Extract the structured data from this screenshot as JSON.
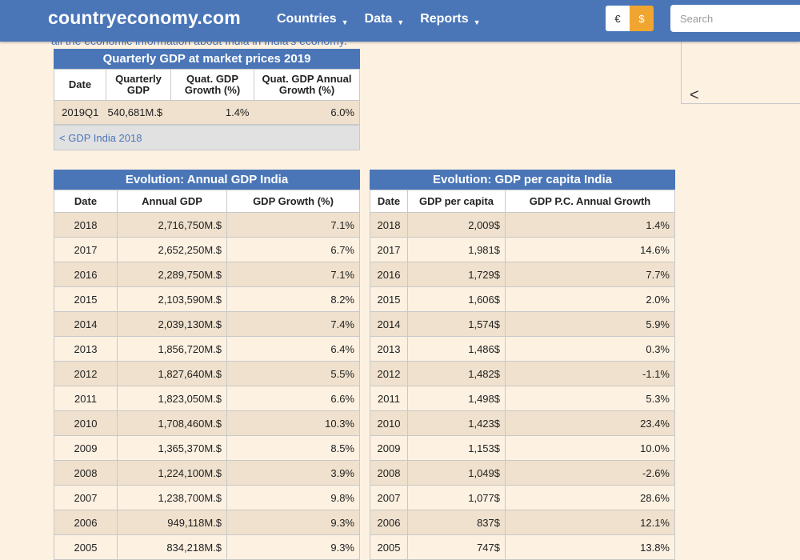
{
  "header": {
    "logo": "countryeconomy.com",
    "nav": [
      {
        "label": "Countries"
      },
      {
        "label": "Data"
      },
      {
        "label": "Reports"
      }
    ],
    "currency_euro": "€",
    "currency_usd": "$",
    "search_placeholder": "Search"
  },
  "intro_text_partial": "all the economic information about India in India's economy.",
  "side_chevron": "<",
  "quarterly": {
    "title": "Quarterly GDP at market prices 2019",
    "headers": [
      "Date",
      "Quarterly GDP",
      "Quat. GDP Growth (%)",
      "Quat. GDP Annual Growth (%)"
    ],
    "rows": [
      [
        "2019Q1",
        "540,681M.$",
        "1.4%",
        "6.0%"
      ]
    ],
    "prev_link": "< GDP India 2018"
  },
  "annual": {
    "title": "Evolution: Annual GDP India",
    "headers": [
      "Date",
      "Annual GDP",
      "GDP Growth (%)"
    ],
    "rows": [
      [
        "2018",
        "2,716,750M.$",
        "7.1%"
      ],
      [
        "2017",
        "2,652,250M.$",
        "6.7%"
      ],
      [
        "2016",
        "2,289,750M.$",
        "7.1%"
      ],
      [
        "2015",
        "2,103,590M.$",
        "8.2%"
      ],
      [
        "2014",
        "2,039,130M.$",
        "7.4%"
      ],
      [
        "2013",
        "1,856,720M.$",
        "6.4%"
      ],
      [
        "2012",
        "1,827,640M.$",
        "5.5%"
      ],
      [
        "2011",
        "1,823,050M.$",
        "6.6%"
      ],
      [
        "2010",
        "1,708,460M.$",
        "10.3%"
      ],
      [
        "2009",
        "1,365,370M.$",
        "8.5%"
      ],
      [
        "2008",
        "1,224,100M.$",
        "3.9%"
      ],
      [
        "2007",
        "1,238,700M.$",
        "9.8%"
      ],
      [
        "2006",
        "949,118M.$",
        "9.3%"
      ],
      [
        "2005",
        "834,218M.$",
        "9.3%"
      ]
    ]
  },
  "per_capita": {
    "title": "Evolution: GDP per capita India",
    "headers": [
      "Date",
      "GDP per capita",
      "GDP P.C. Annual Growth"
    ],
    "rows": [
      [
        "2018",
        "2,009$",
        "1.4%"
      ],
      [
        "2017",
        "1,981$",
        "14.6%"
      ],
      [
        "2016",
        "1,729$",
        "7.7%"
      ],
      [
        "2015",
        "1,606$",
        "2.0%"
      ],
      [
        "2014",
        "1,574$",
        "5.9%"
      ],
      [
        "2013",
        "1,486$",
        "0.3%"
      ],
      [
        "2012",
        "1,482$",
        "-1.1%"
      ],
      [
        "2011",
        "1,498$",
        "5.3%"
      ],
      [
        "2010",
        "1,423$",
        "23.4%"
      ],
      [
        "2009",
        "1,153$",
        "10.0%"
      ],
      [
        "2008",
        "1,049$",
        "-2.6%"
      ],
      [
        "2007",
        "1,077$",
        "28.6%"
      ],
      [
        "2006",
        "837$",
        "12.1%"
      ],
      [
        "2005",
        "747$",
        "13.8%"
      ]
    ]
  }
}
